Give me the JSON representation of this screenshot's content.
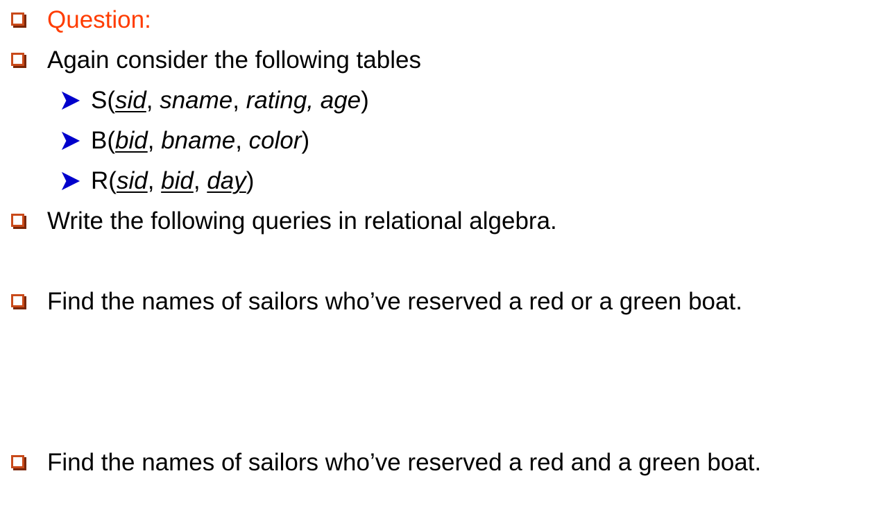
{
  "slide": {
    "question_label": "Question:",
    "intro": "Again consider the following tables",
    "tables": [
      {
        "name": "S",
        "open": "(",
        "close": ")",
        "attrs": [
          {
            "name": "sid",
            "key": true,
            "sep": ", "
          },
          {
            "name": "sname",
            "key": false,
            "sep": ", "
          },
          {
            "name": "rating, age",
            "key": false,
            "sep": ""
          }
        ]
      },
      {
        "name": "B",
        "open": "(",
        "close": ")",
        "attrs": [
          {
            "name": "bid",
            "key": true,
            "sep": ", "
          },
          {
            "name": "bname",
            "key": false,
            "sep": ", "
          },
          {
            "name": "color",
            "key": false,
            "sep": ""
          }
        ]
      },
      {
        "name": "R",
        "open": "(",
        "close": ")",
        "attrs": [
          {
            "name": "sid",
            "key": true,
            "sep": ", "
          },
          {
            "name": "bid",
            "key": true,
            "sep": ", "
          },
          {
            "name": "day",
            "key": true,
            "sep": ""
          }
        ]
      }
    ],
    "instruction": "Write the following queries in relational algebra.",
    "query1": "Find the names of sailors who’ve reserved a red or a green boat.",
    "query2": "Find the names of sailors who’ve reserved a red and a green boat.",
    "colors": {
      "question": "#ff3c00",
      "bullet": "#c94a1a",
      "arrow": "#0000cc"
    }
  }
}
